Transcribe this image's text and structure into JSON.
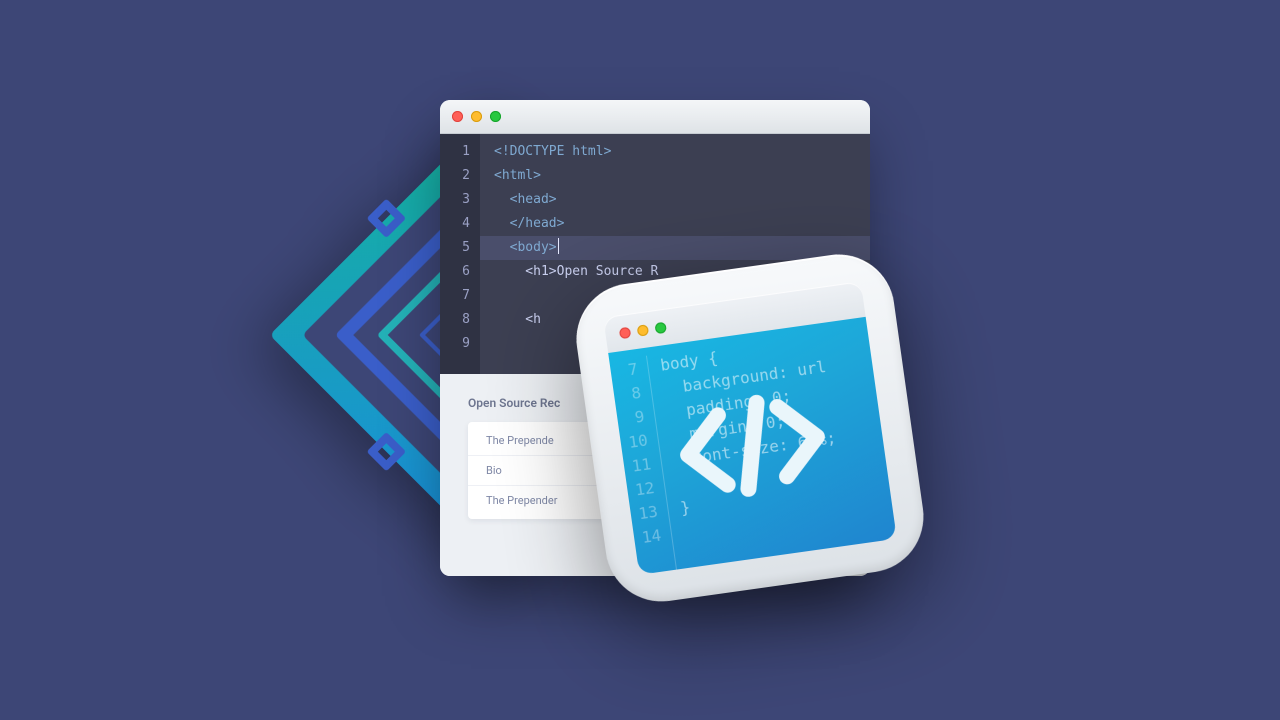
{
  "editor": {
    "line_numbers": [
      "1",
      "2",
      "3",
      "4",
      "5",
      "6",
      "7",
      "8",
      "9"
    ],
    "code_lines": {
      "l1": "<!DOCTYPE html>",
      "l2": "<html>",
      "l3": "  <head>",
      "l4": "  </head>",
      "l5": "  <body>",
      "l6": "    <h1>Open Source R",
      "l7": "",
      "l8": "    <h",
      "l9": ""
    },
    "highlighted_line": 5
  },
  "preview": {
    "heading": "Open Source Rec",
    "items": [
      "The Prepende",
      "Bio",
      "The Prepender"
    ]
  },
  "icon_code": {
    "line_numbers": [
      "7",
      "8",
      "9",
      "10",
      "11",
      "12",
      "13",
      "14"
    ],
    "lines": {
      "l1": "body {",
      "l2": "  background: url",
      "l3": "  padding: 0;",
      "l4": "  margin: 0;",
      "l5": "  font-size: 66%;",
      "l6": "",
      "l7": "}",
      "l8": ""
    }
  },
  "colors": {
    "background": "#3d4676",
    "editor_bg": "#3c3f52",
    "gutter_bg": "#2f3243",
    "icon_gradient_from": "#18b7e3",
    "icon_gradient_to": "#1f85cf"
  }
}
